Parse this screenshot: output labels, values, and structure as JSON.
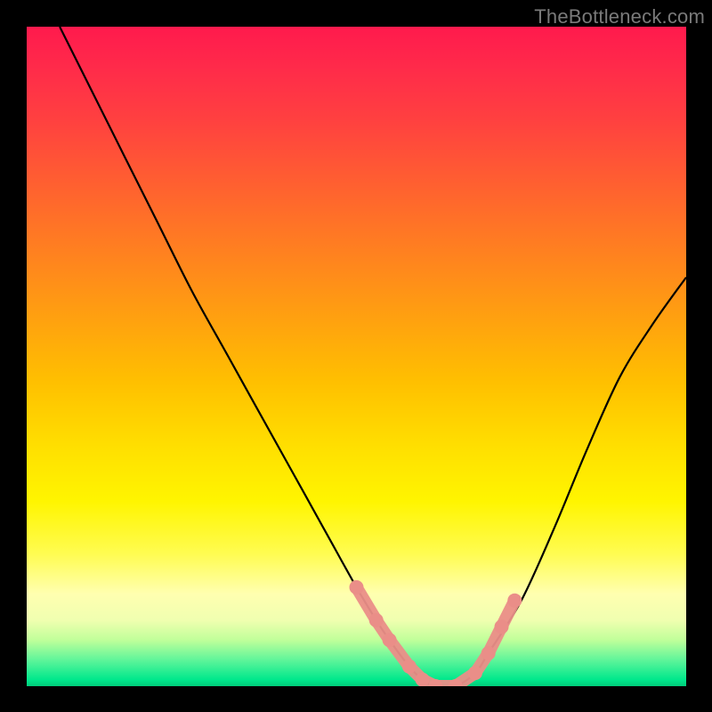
{
  "watermark": "TheBottleneck.com",
  "chart_data": {
    "type": "line",
    "title": "",
    "xlabel": "",
    "ylabel": "",
    "xlim": [
      0,
      100
    ],
    "ylim": [
      0,
      100
    ],
    "grid": false,
    "series": [
      {
        "name": "bottleneck-curve",
        "color": "#000000",
        "x": [
          5,
          10,
          15,
          20,
          25,
          30,
          35,
          40,
          45,
          50,
          53,
          55,
          58,
          60,
          62,
          65,
          68,
          70,
          75,
          80,
          85,
          90,
          95,
          100
        ],
        "values": [
          100,
          90,
          80,
          70,
          60,
          51,
          42,
          33,
          24,
          15,
          10,
          7,
          3,
          1,
          0,
          0,
          2,
          5,
          13,
          24,
          36,
          47,
          55,
          62
        ]
      }
    ],
    "markers": {
      "name": "highlight-dots",
      "color": "#ea8e88",
      "points": [
        {
          "x": 50,
          "y": 15
        },
        {
          "x": 53,
          "y": 10
        },
        {
          "x": 55,
          "y": 7
        },
        {
          "x": 58,
          "y": 3
        },
        {
          "x": 60,
          "y": 1
        },
        {
          "x": 62,
          "y": 0
        },
        {
          "x": 65,
          "y": 0
        },
        {
          "x": 68,
          "y": 2
        },
        {
          "x": 70,
          "y": 5
        },
        {
          "x": 72,
          "y": 9
        },
        {
          "x": 74,
          "y": 13
        }
      ]
    },
    "background_gradient": {
      "top": "#ff1a4d",
      "mid": "#ffe000",
      "bottom": "#00e88c"
    }
  }
}
